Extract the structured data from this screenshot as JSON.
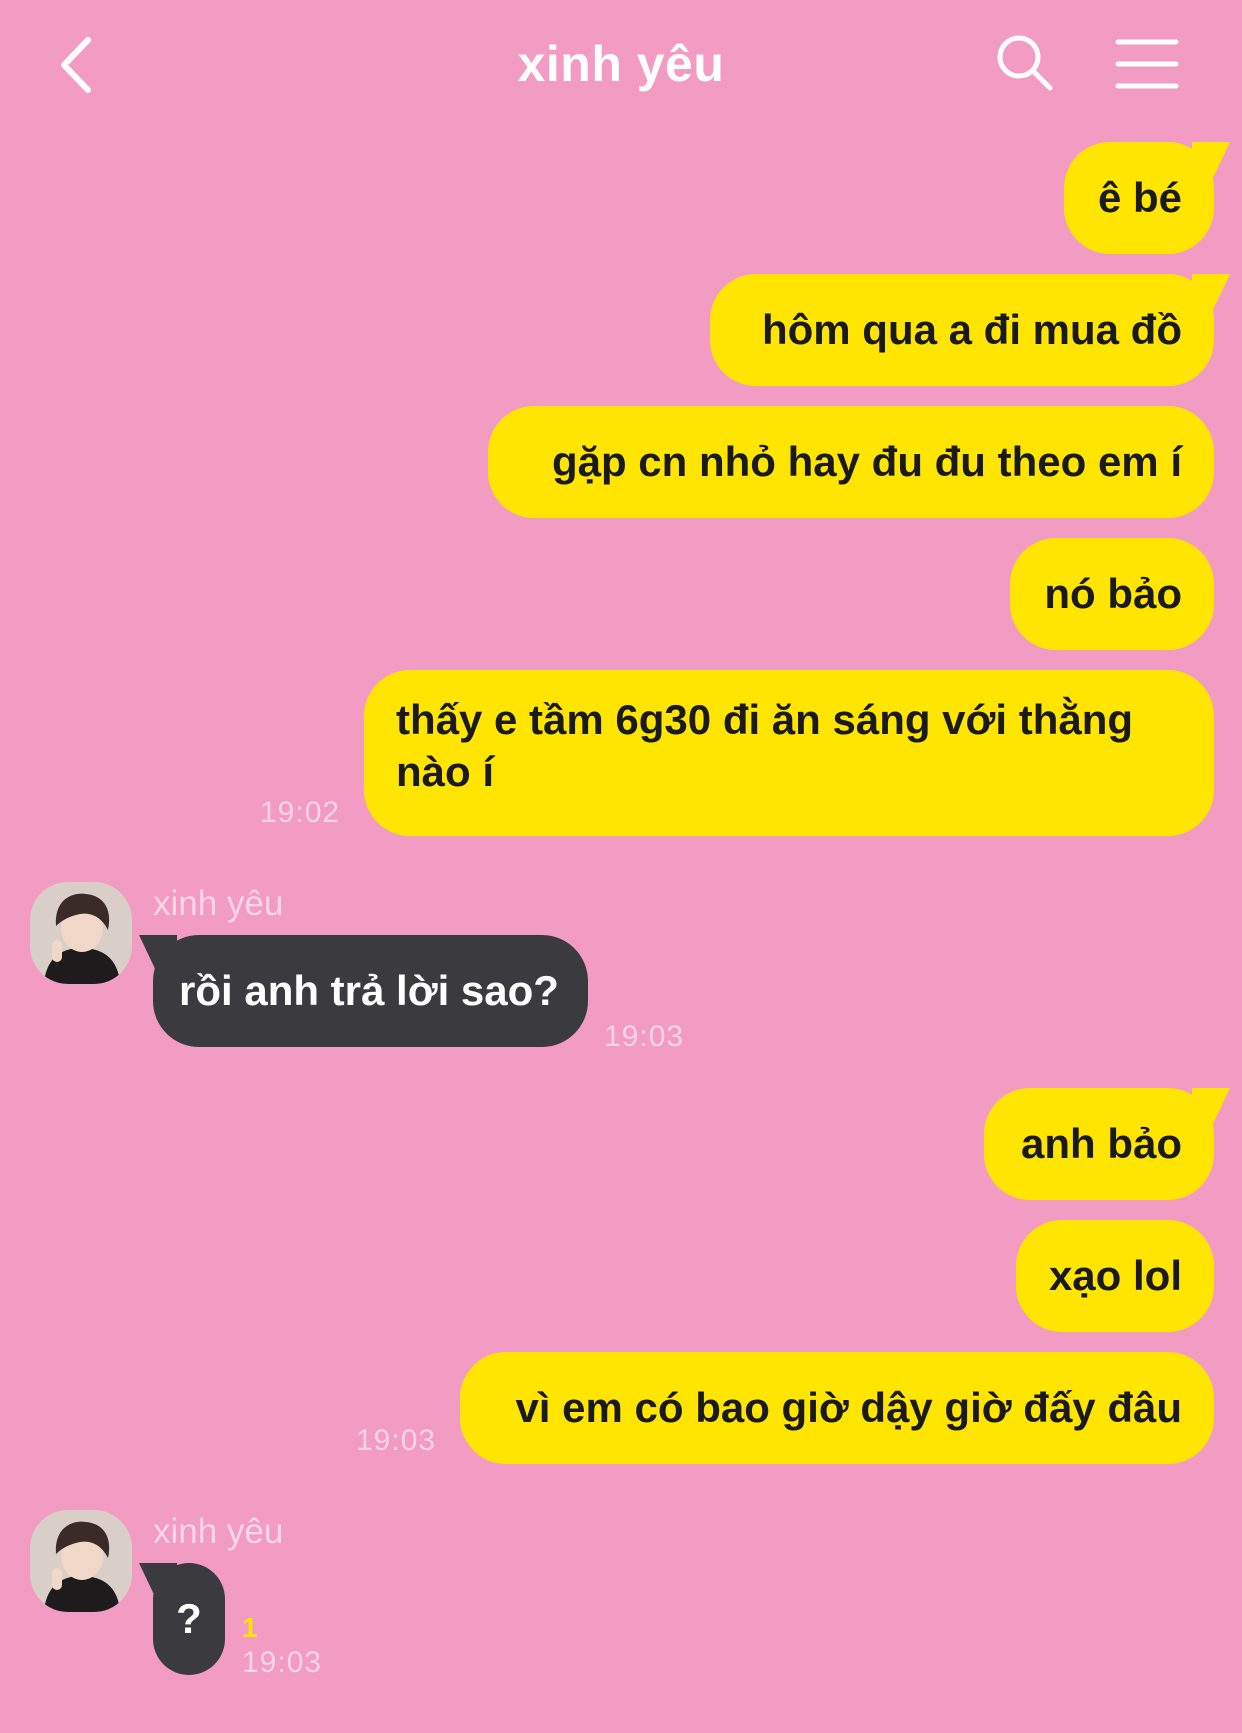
{
  "header": {
    "title": "xinh yêu",
    "back_icon": "chevron-left-icon",
    "search_icon": "search-icon",
    "menu_icon": "hamburger-menu-icon"
  },
  "colors": {
    "background": "#f29bc3",
    "outgoing_bubble": "#ffe500",
    "incoming_bubble": "#3b3a3f",
    "unread_count": "#ffe500"
  },
  "messages": [
    {
      "direction": "outgoing",
      "text": "ê bé"
    },
    {
      "direction": "outgoing",
      "text": "hôm qua a đi mua đồ"
    },
    {
      "direction": "outgoing",
      "text": "gặp cn nhỏ hay đu đu theo em í"
    },
    {
      "direction": "outgoing",
      "text": "nó bảo"
    },
    {
      "direction": "outgoing",
      "text": "thấy e tầm 6g30 đi ăn sáng với thằng nào í",
      "time": "19:02"
    },
    {
      "direction": "incoming",
      "sender": "xinh yêu",
      "text": "rồi anh trả lời sao?",
      "time": "19:03"
    },
    {
      "direction": "outgoing",
      "text": "anh bảo"
    },
    {
      "direction": "outgoing",
      "text": "xạo lol"
    },
    {
      "direction": "outgoing",
      "text": "vì em có bao giờ dậy giờ đấy đâu",
      "time": "19:03"
    },
    {
      "direction": "incoming",
      "sender": "xinh yêu",
      "text": "?",
      "unread": "1",
      "time": "19:03"
    }
  ]
}
